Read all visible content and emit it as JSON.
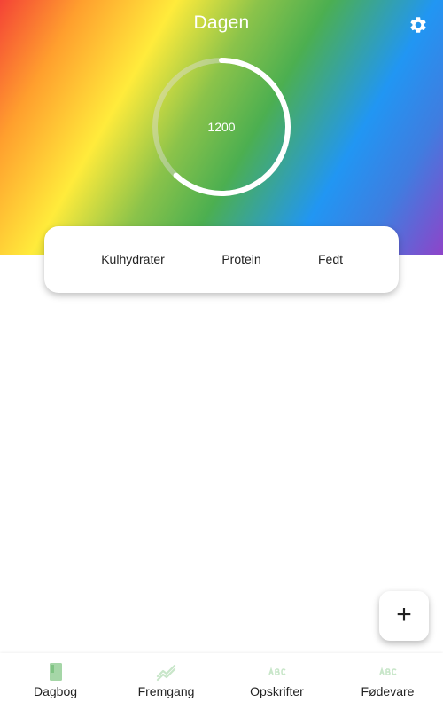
{
  "header": {
    "title": "Dagen",
    "settings_icon": "gear-icon"
  },
  "calorie_ring": {
    "value": "1200",
    "progress": 0.62,
    "track_color": "#e0e0e0",
    "progress_color": "#ffffff"
  },
  "macros": {
    "items": [
      {
        "label": "Kulhydrater"
      },
      {
        "label": "Protein"
      },
      {
        "label": "Fedt"
      }
    ]
  },
  "fab": {
    "label": "+",
    "icon": "plus-icon"
  },
  "bottom_nav": {
    "items": [
      {
        "label": "Dagbog",
        "icon": "book-icon",
        "active": true
      },
      {
        "label": "Fremgang",
        "icon": "trending-up-icon",
        "active": false
      },
      {
        "label": "Opskrifter",
        "icon": "abc-icon",
        "active": false
      },
      {
        "label": "Fødevare",
        "icon": "abc-icon",
        "active": false
      }
    ]
  },
  "colors": {
    "accent_green": "#4caf50",
    "inactive_green": "#c8e6c9",
    "text": "#222222"
  }
}
